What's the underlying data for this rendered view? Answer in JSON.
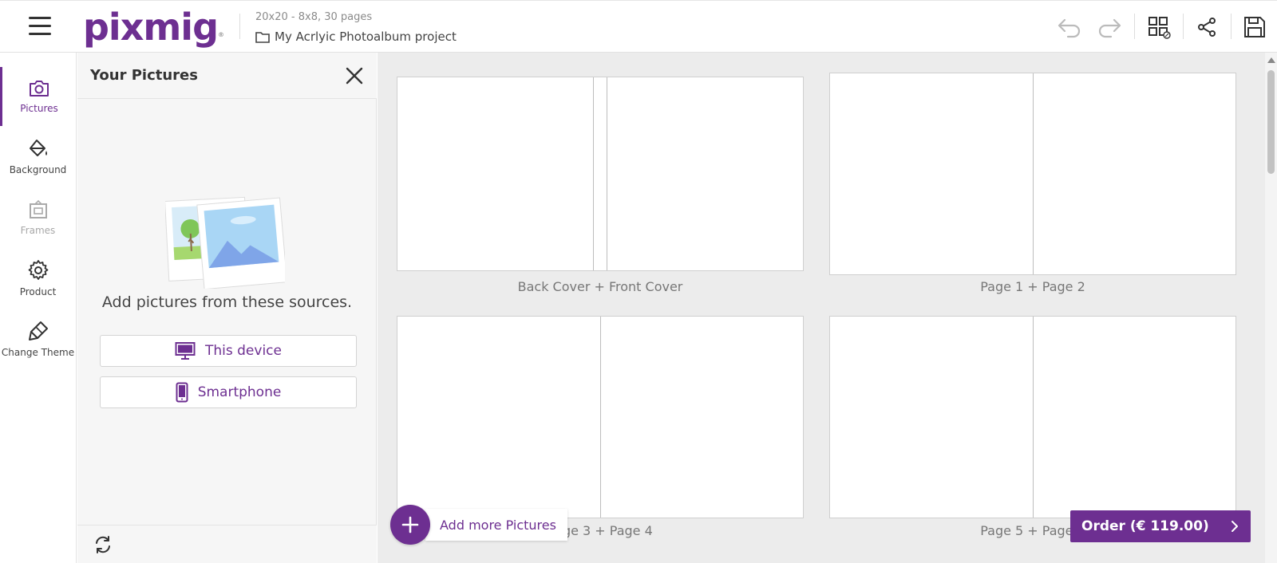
{
  "app": {
    "logo_text": "pixmig",
    "brand_color": "#6d2f91",
    "project_subtitle": "20x20 - 8x8, 30 pages",
    "project_title": "My Acrlyic Photoalbum project"
  },
  "toolbar": {
    "icons": [
      "undo-icon",
      "redo-icon",
      "layout-grid-icon",
      "share-icon",
      "save-icon"
    ]
  },
  "rail": {
    "items": [
      {
        "label": "Pictures",
        "icon": "camera-icon",
        "state": "active"
      },
      {
        "label": "Background",
        "icon": "paint-bucket-icon",
        "state": "normal"
      },
      {
        "label": "Frames",
        "icon": "frame-icon",
        "state": "disabled"
      },
      {
        "label": "Product",
        "icon": "gear-icon",
        "state": "normal"
      },
      {
        "label": "Change Theme",
        "icon": "brush-icon",
        "state": "normal"
      }
    ]
  },
  "panel": {
    "title": "Your Pictures",
    "hint": "Add pictures from these sources.",
    "sources": [
      {
        "label": "This device",
        "icon": "monitor-icon"
      },
      {
        "label": "Smartphone",
        "icon": "smartphone-icon"
      }
    ]
  },
  "workspace": {
    "spreads": [
      {
        "caption": "Back Cover + Front Cover"
      },
      {
        "caption": "Page 1 + Page 2"
      },
      {
        "caption": "Page 3 + Page 4"
      },
      {
        "caption": "Page 5 + Page 6"
      }
    ],
    "add_more_label": "Add more Pictures",
    "order_label": "Order (€ 119.00)"
  }
}
